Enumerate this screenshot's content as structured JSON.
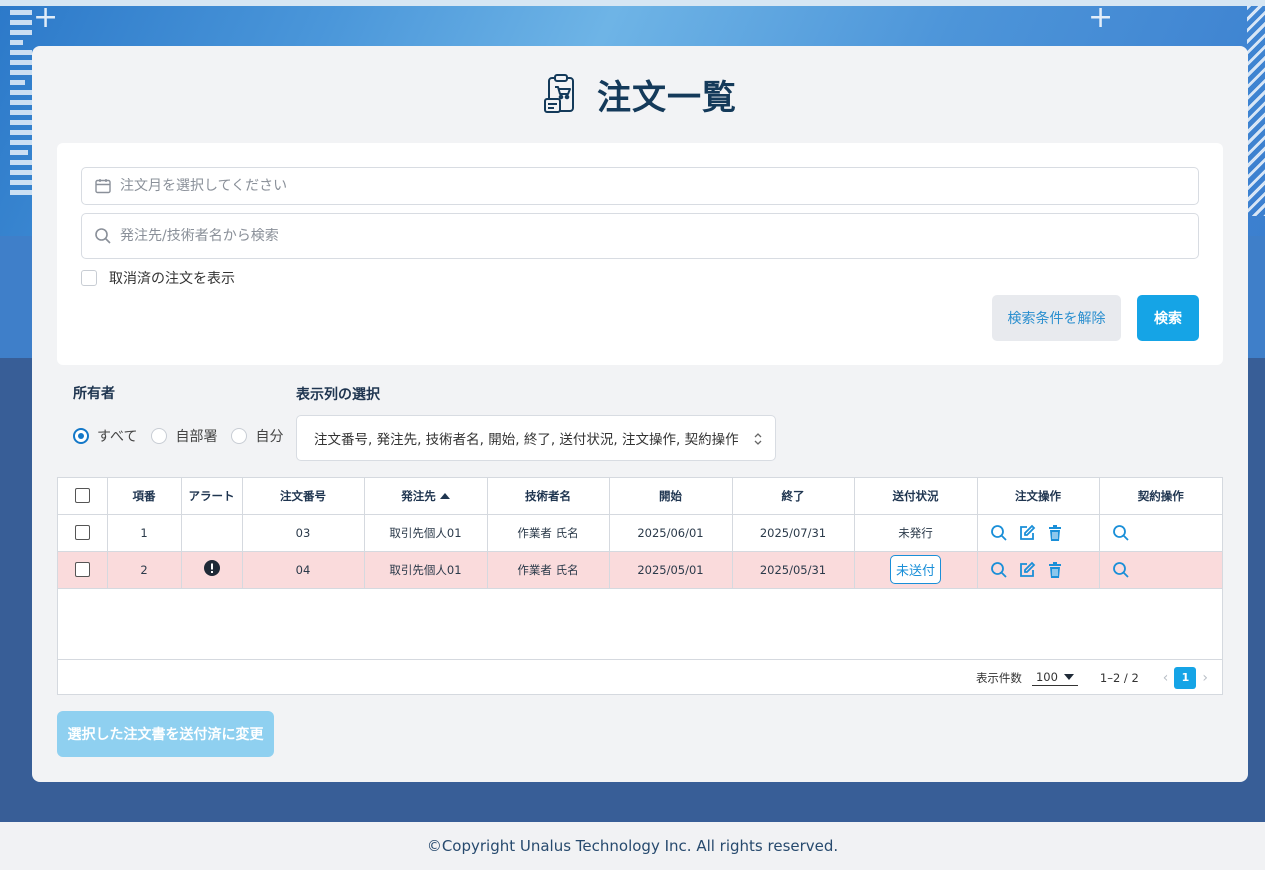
{
  "page": {
    "title": "注文一覧"
  },
  "search": {
    "month_placeholder": "注文月を選択してください",
    "keyword_placeholder": "発注先/技術者名から検索",
    "show_cancelled_label": "取消済の注文を表示",
    "clear_label": "検索条件を解除",
    "search_label": "検索"
  },
  "owner": {
    "label": "所有者",
    "options": [
      "すべて",
      "自部署",
      "自分"
    ],
    "selected": "すべて"
  },
  "columns": {
    "label": "表示列の選択",
    "value": "注文番号, 発注先, 技術者名, 開始, 終了, 送付状況, 注文操作, 契約操作"
  },
  "table": {
    "headers": [
      "項番",
      "アラート",
      "注文番号",
      "発注先",
      "技術者名",
      "開始",
      "終了",
      "送付状況",
      "注文操作",
      "契約操作"
    ],
    "sorted_column": "発注先",
    "rows": [
      {
        "no": "1",
        "alert": false,
        "order_no": "03",
        "supplier": "取引先個人01",
        "engineer": "作業者 氏名",
        "start": "2025/06/01",
        "end": "2025/07/31",
        "status": "未発行",
        "status_badge": false
      },
      {
        "no": "2",
        "alert": true,
        "order_no": "04",
        "supplier": "取引先個人01",
        "engineer": "作業者 氏名",
        "start": "2025/05/01",
        "end": "2025/05/31",
        "status": "未送付",
        "status_badge": true
      }
    ]
  },
  "pagination": {
    "per_page_label": "表示件数",
    "per_page": "100",
    "range": "1–2 / 2",
    "current_page": "1",
    "prev_icon": "chevron-left-icon",
    "next_icon": "chevron-right-icon"
  },
  "bulk_button": "選択した注文書を送付済に変更",
  "footer": "©Copyright Unalus Technology Inc. All rights reserved.",
  "colors": {
    "accent": "#15a4e6",
    "title": "#143a5a",
    "alert_row": "#fadbdc",
    "bg_dark": "#385e97"
  }
}
